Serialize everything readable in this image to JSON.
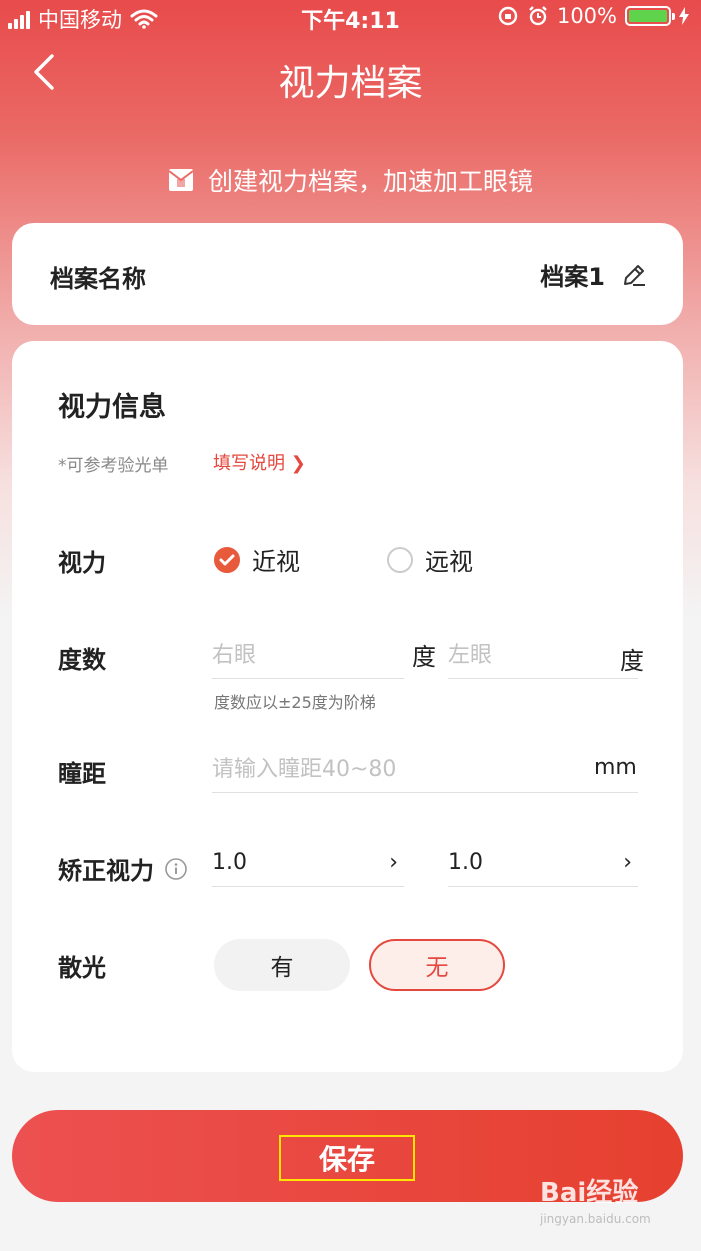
{
  "status_bar": {
    "carrier": "中国移动",
    "time": "下午4:11",
    "battery_percent": "100%",
    "battery_level": 1.0
  },
  "nav": {
    "title": "视力档案",
    "back_icon": "chevron-left-icon"
  },
  "banner": {
    "text": "创建视力档案，加速加工眼镜",
    "icon": "envelope-icon"
  },
  "profile": {
    "label": "档案名称",
    "value": "档案1",
    "edit_icon": "pencil-icon"
  },
  "vision_info": {
    "title": "视力信息",
    "hint": "*可参考验光单",
    "hint_link": "填写说明 ❯",
    "vision_type": {
      "label": "视力",
      "options": [
        "近视",
        "远视"
      ],
      "selected": "近视"
    },
    "degree": {
      "label": "度数",
      "right_placeholder": "右眼",
      "left_placeholder": "左眼",
      "unit": "度",
      "hint": "度数应以±25度为阶梯"
    },
    "pupil_distance": {
      "label": "瞳距",
      "placeholder": "请输入瞳距40~80",
      "unit": "mm"
    },
    "corrected_vision": {
      "label": "矫正视力",
      "right_value": "1.0",
      "left_value": "1.0",
      "arrow": "›"
    },
    "astigmatism": {
      "label": "散光",
      "options": [
        "有",
        "无"
      ],
      "selected": "无"
    }
  },
  "save_button": {
    "label": "保存"
  },
  "watermark": {
    "text": "Bai经验",
    "url_text": "jingyan.baidu.com"
  },
  "colors": {
    "accent": "#e4483f",
    "header_top": "#e84b4b",
    "check": "#e85a3c"
  }
}
